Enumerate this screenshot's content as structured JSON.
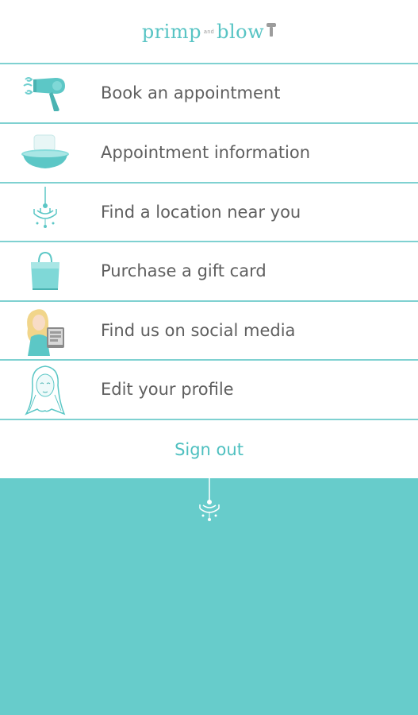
{
  "header": {
    "logo_word1": "primp",
    "logo_word2": "and",
    "logo_word3": "blow"
  },
  "menu": {
    "items": [
      {
        "label": "Book an appointment",
        "icon": "hair-dryer-icon"
      },
      {
        "label": "Appointment information",
        "icon": "wash-basin-icon"
      },
      {
        "label": "Find a location near you",
        "icon": "chandelier-icon"
      },
      {
        "label": "Purchase a gift card",
        "icon": "shopping-bag-icon"
      },
      {
        "label": "Find us on social media",
        "icon": "girl-with-tablet-icon"
      },
      {
        "label": "Edit your profile",
        "icon": "woman-portrait-icon"
      }
    ],
    "signout_label": "Sign out"
  },
  "colors": {
    "accent": "#58c4c4",
    "divider": "#7fd1d1",
    "footer": "#67cccb",
    "text": "#5f5f5f"
  }
}
